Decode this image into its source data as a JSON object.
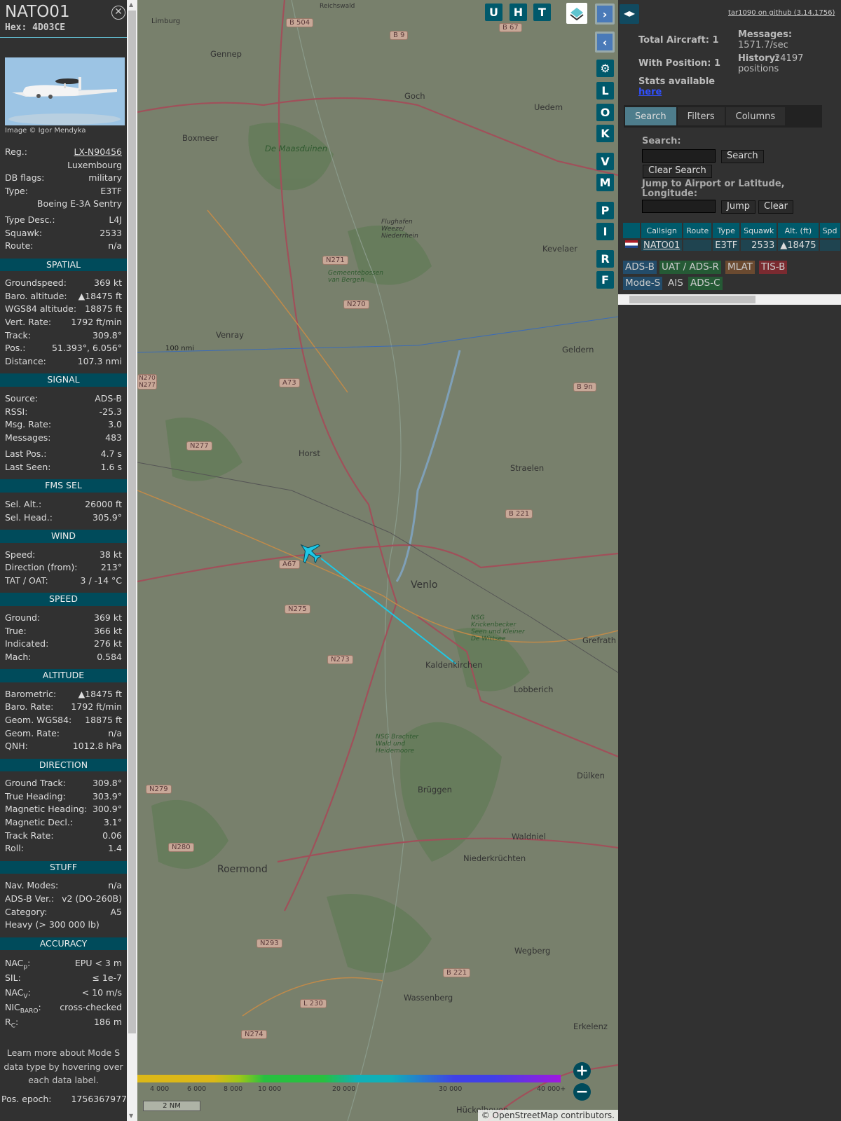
{
  "aircraft": {
    "callsign": "NATO01",
    "hex_label": "Hex:",
    "hex": "4D03CE",
    "image_credit": "Image © Igor Mendyka"
  },
  "info": [
    {
      "label": "Reg.:",
      "value": "LX-N90456",
      "link": true
    },
    {
      "label": "",
      "value": "Luxembourg"
    },
    {
      "label": "DB flags:",
      "value": "military"
    },
    {
      "label": "Type:",
      "value": "E3TF"
    },
    {
      "label": "",
      "value": "Boeing E-3A Sentry"
    },
    {
      "label": "Type Desc.:",
      "value": "L4J"
    },
    {
      "label": "Squawk:",
      "value": "2533"
    },
    {
      "label": "Route:",
      "value": "n/a"
    }
  ],
  "sections": [
    {
      "title": "SPATIAL",
      "rows": [
        [
          "Groundspeed:",
          "369 kt"
        ],
        [
          "Baro. altitude:",
          "▲18475 ft"
        ],
        [
          "WGS84 altitude:",
          "18875 ft"
        ],
        [
          "Vert. Rate:",
          "1792 ft/min"
        ],
        [
          "Track:",
          "309.8°"
        ],
        [
          "Pos.:",
          "51.393°, 6.056°"
        ],
        [
          "Distance:",
          "107.3 nmi"
        ]
      ]
    },
    {
      "title": "SIGNAL",
      "rows": [
        [
          "Source:",
          "ADS-B"
        ],
        [
          "RSSI:",
          "-25.3"
        ],
        [
          "Msg. Rate:",
          "3.0"
        ],
        [
          "Messages:",
          "483"
        ],
        [
          "Last Pos.:",
          "4.7 s"
        ],
        [
          "Last Seen:",
          "1.6 s"
        ]
      ]
    },
    {
      "title": "FMS SEL",
      "rows": [
        [
          "Sel. Alt.:",
          "26000 ft"
        ],
        [
          "Sel. Head.:",
          "305.9°"
        ]
      ]
    },
    {
      "title": "WIND",
      "rows": [
        [
          "Speed:",
          "38 kt"
        ],
        [
          "Direction (from):",
          "213°"
        ],
        [
          "TAT / OAT:",
          "3 / -14 °C"
        ]
      ]
    },
    {
      "title": "SPEED",
      "rows": [
        [
          "Ground:",
          "369 kt"
        ],
        [
          "True:",
          "366 kt"
        ],
        [
          "Indicated:",
          "276 kt"
        ],
        [
          "Mach:",
          "0.584"
        ]
      ]
    },
    {
      "title": "ALTITUDE",
      "rows": [
        [
          "Barometric:",
          "▲18475 ft"
        ],
        [
          "Baro. Rate:",
          "1792 ft/min"
        ],
        [
          "Geom. WGS84:",
          "18875 ft"
        ],
        [
          "Geom. Rate:",
          "n/a"
        ],
        [
          "QNH:",
          "1012.8 hPa"
        ]
      ]
    },
    {
      "title": "DIRECTION",
      "rows": [
        [
          "Ground Track:",
          "309.8°"
        ],
        [
          "True Heading:",
          "303.9°"
        ],
        [
          "Magnetic Heading:",
          "300.9°"
        ],
        [
          "Magnetic Decl.:",
          "3.1°"
        ],
        [
          "Track Rate:",
          "0.06"
        ],
        [
          "Roll:",
          "1.4"
        ]
      ]
    },
    {
      "title": "STUFF",
      "rows": [
        [
          "Nav. Modes:",
          "n/a"
        ],
        [
          "ADS-B Ver.:",
          "v2 (DO-260B)"
        ],
        [
          "Category:",
          "A5"
        ],
        [
          "Heavy (> 300 000 lb)",
          ""
        ]
      ]
    },
    {
      "title": "ACCURACY",
      "rows": [
        [
          "NAC",
          "p",
          ":",
          "EPU < 3 m"
        ],
        [
          "SIL:",
          "",
          "",
          "≤ 1e-7"
        ],
        [
          "NAC",
          "V",
          ":",
          "< 10 m/s"
        ],
        [
          "NIC",
          "BARO",
          ":",
          "cross-checked"
        ],
        [
          "R",
          "C",
          ":",
          "186 m"
        ]
      ]
    }
  ],
  "note": "Learn more about Mode S data type by hovering over each data label.",
  "pos_epoch": {
    "label": "Pos. epoch:",
    "value": "1756367977"
  },
  "map": {
    "top_buttons": [
      "U",
      "H",
      "T"
    ],
    "side_buttons": [
      "L",
      "O",
      "K",
      "V",
      "M",
      "P",
      "I",
      "R",
      "F"
    ],
    "places": [
      "Gennep",
      "Goch",
      "Uedem",
      "Boxmeer",
      "De Maasduinen",
      "Flughafen Weeze/ Niederrhein",
      "Kevelaer",
      "Gemeentebossen van Bergen",
      "Venray",
      "Geldern",
      "Horst",
      "Straelen",
      "Venlo",
      "Kaldenkirchen",
      "Lobberich",
      "Grefrath",
      "Brüggen",
      "Dülken",
      "Waldniel",
      "Niederkrüchten",
      "Roermond",
      "Wegberg",
      "Wassenberg",
      "Erkelenz",
      "Hückelhoven",
      "Reichswald",
      "Limburg",
      "NSG Krickenbecker Seen und Kleiner De Wittsee",
      "NSG Brachter Wald und Heidemoore"
    ],
    "roads": [
      "B 504",
      "B 67",
      "B 9",
      "N271",
      "N270",
      "A73",
      "N277",
      "B 9n",
      "N270 N277",
      "A67",
      "N275",
      "N273",
      "B 221",
      "N279",
      "N280",
      "N293",
      "L 230",
      "N274",
      "B 221"
    ],
    "range_label": "100 nmi",
    "altitude_legend": [
      "4 000",
      "6 000",
      "8 000",
      "10 000",
      "20 000",
      "30 000",
      "40 000+"
    ],
    "scale": "2 NM",
    "attribution": "© OpenStreetMap contributors.",
    "zoom_in": "+",
    "zoom_out": "−"
  },
  "right": {
    "github": "tar1090 on github (3.14.1756)",
    "total_aircraft": "Total Aircraft: 1",
    "with_position": "With Position: 1",
    "messages_label": "Messages:",
    "messages": "1571.7/sec",
    "history_label": "History:",
    "history": "24197 positions",
    "stats": "Stats available",
    "stats_link": "here",
    "tabs": [
      "Search",
      "Filters",
      "Columns"
    ],
    "search_label": "Search:",
    "search_button": "Search",
    "clear_search": "Clear Search",
    "jump_label": "Jump to Airport or Latitude, Longitude:",
    "jump_button": "Jump",
    "clear_button": "Clear",
    "columns": [
      "",
      "Callsign",
      "Route",
      "Type",
      "Squawk",
      "Alt. (ft)",
      "Spd"
    ],
    "row": {
      "callsign": "NATO01",
      "route": "",
      "type": "E3TF",
      "squawk": "2533",
      "alt": "▲18475"
    },
    "sources": [
      "ADS-B",
      "UAT / ADS-R",
      "MLAT",
      "TIS-B",
      "Mode-S",
      "AIS",
      "ADS-C"
    ]
  },
  "colors": {
    "accent": "#004b5b",
    "button": "#00596b",
    "track": "#1ec8e6"
  }
}
